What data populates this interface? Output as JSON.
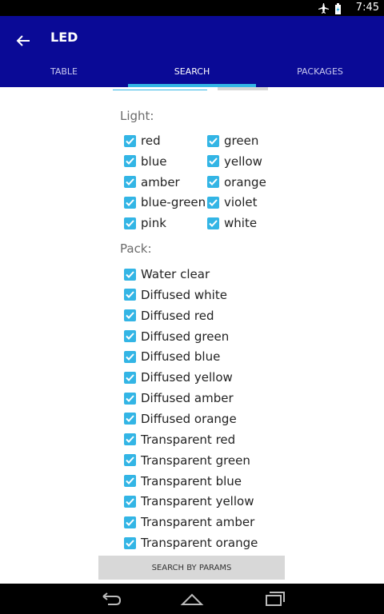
{
  "status": {
    "time": "7:45",
    "icons": [
      "airplane-icon",
      "battery-charging-icon"
    ]
  },
  "appbar": {
    "title": "LED",
    "back_icon": "arrow-back-icon"
  },
  "tabs": [
    {
      "label": "TABLE",
      "active": false
    },
    {
      "label": "SEARCH",
      "active": true
    },
    {
      "label": "PACKAGES",
      "active": false
    }
  ],
  "light": {
    "label": "Light:",
    "items": [
      {
        "label": "red",
        "checked": true
      },
      {
        "label": "green",
        "checked": true
      },
      {
        "label": "blue",
        "checked": true
      },
      {
        "label": "yellow",
        "checked": true
      },
      {
        "label": "amber",
        "checked": true
      },
      {
        "label": "orange",
        "checked": true
      },
      {
        "label": "blue-green",
        "checked": true
      },
      {
        "label": "violet",
        "checked": true
      },
      {
        "label": "pink",
        "checked": true
      },
      {
        "label": "white",
        "checked": true
      }
    ]
  },
  "pack": {
    "label": "Pack:",
    "items": [
      {
        "label": "Water clear",
        "checked": true
      },
      {
        "label": "Diffused white",
        "checked": true
      },
      {
        "label": "Diffused red",
        "checked": true
      },
      {
        "label": "Diffused green",
        "checked": true
      },
      {
        "label": "Diffused blue",
        "checked": true
      },
      {
        "label": "Diffused yellow",
        "checked": true
      },
      {
        "label": "Diffused amber",
        "checked": true
      },
      {
        "label": "Diffused orange",
        "checked": true
      },
      {
        "label": "Transparent red",
        "checked": true
      },
      {
        "label": "Transparent green",
        "checked": true
      },
      {
        "label": "Transparent blue",
        "checked": true
      },
      {
        "label": "Transparent yellow",
        "checked": true
      },
      {
        "label": "Transparent amber",
        "checked": true
      },
      {
        "label": "Transparent orange",
        "checked": true
      }
    ]
  },
  "search_button": {
    "label": "SEARCH BY PARAMS"
  },
  "navbar": {
    "icons": [
      "back-nav-icon",
      "home-icon",
      "recent-apps-icon"
    ]
  },
  "colors": {
    "appbar": "#0a0a96",
    "accent": "#33b5e5"
  }
}
